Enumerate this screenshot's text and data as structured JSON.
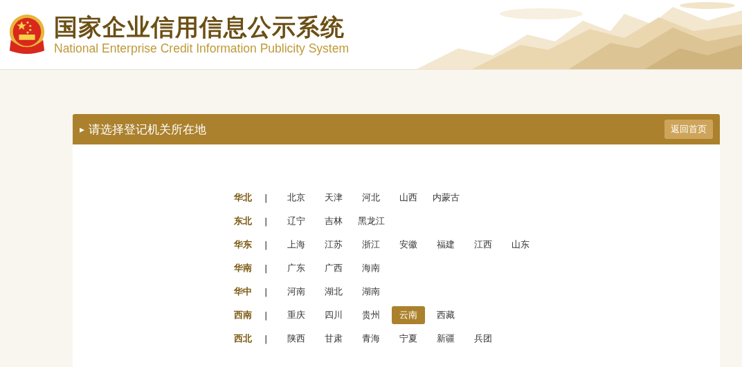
{
  "header": {
    "title": "国家企业信用信息公示系统",
    "subtitle": "National Enterprise Credit Information Publicity System"
  },
  "panel": {
    "arrow": "▸",
    "title": "请选择登记机关所在地",
    "home_button": "返回首页",
    "regions": [
      {
        "name": "华北",
        "separator": "|",
        "provinces": [
          {
            "label": "北京",
            "selected": false
          },
          {
            "label": "天津",
            "selected": false
          },
          {
            "label": "河北",
            "selected": false
          },
          {
            "label": "山西",
            "selected": false
          },
          {
            "label": "内蒙古",
            "selected": false
          }
        ]
      },
      {
        "name": "东北",
        "separator": "|",
        "provinces": [
          {
            "label": "辽宁",
            "selected": false
          },
          {
            "label": "吉林",
            "selected": false
          },
          {
            "label": "黑龙江",
            "selected": false
          }
        ]
      },
      {
        "name": "华东",
        "separator": "|",
        "provinces": [
          {
            "label": "上海",
            "selected": false
          },
          {
            "label": "江苏",
            "selected": false
          },
          {
            "label": "浙江",
            "selected": false
          },
          {
            "label": "安徽",
            "selected": false
          },
          {
            "label": "福建",
            "selected": false
          },
          {
            "label": "江西",
            "selected": false
          },
          {
            "label": "山东",
            "selected": false
          }
        ]
      },
      {
        "name": "华南",
        "separator": "|",
        "provinces": [
          {
            "label": "广东",
            "selected": false
          },
          {
            "label": "广西",
            "selected": false
          },
          {
            "label": "海南",
            "selected": false
          }
        ]
      },
      {
        "name": "华中",
        "separator": "|",
        "provinces": [
          {
            "label": "河南",
            "selected": false
          },
          {
            "label": "湖北",
            "selected": false
          },
          {
            "label": "湖南",
            "selected": false
          }
        ]
      },
      {
        "name": "西南",
        "separator": "|",
        "provinces": [
          {
            "label": "重庆",
            "selected": false
          },
          {
            "label": "四川",
            "selected": false
          },
          {
            "label": "贵州",
            "selected": false
          },
          {
            "label": "云南",
            "selected": true
          },
          {
            "label": "西藏",
            "selected": false
          }
        ]
      },
      {
        "name": "西北",
        "separator": "|",
        "provinces": [
          {
            "label": "陕西",
            "selected": false
          },
          {
            "label": "甘肃",
            "selected": false
          },
          {
            "label": "青海",
            "selected": false
          },
          {
            "label": "宁夏",
            "selected": false
          },
          {
            "label": "新疆",
            "selected": false
          },
          {
            "label": "兵团",
            "selected": false
          }
        ]
      }
    ]
  }
}
